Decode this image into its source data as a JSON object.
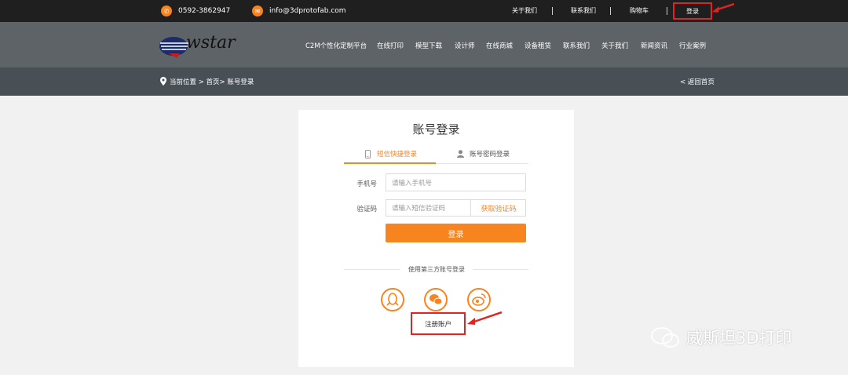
{
  "topbar": {
    "phone": "0592-3862947",
    "email": "info@3dprotofab.com",
    "links": [
      "关于我们",
      "联系我们",
      "购物车"
    ],
    "login": "登录"
  },
  "nav": {
    "logo_text": "wstar",
    "items": [
      "C2M个性化定制平台",
      "在线打印",
      "模型下载",
      "设计师",
      "在线商城",
      "设备租赁",
      "联系我们",
      "关于我们",
      "新闻资讯",
      "行业案例"
    ]
  },
  "breadcrumb": {
    "text": "当前位置 > 首页> 账号登录",
    "back": "< 返回首页"
  },
  "login_card": {
    "title": "账号登录",
    "tabs": [
      "短信快捷登录",
      "账号密码登录"
    ],
    "phone_label": "手机号",
    "phone_placeholder": "请输入手机号",
    "code_label": "验证码",
    "code_placeholder": "请输入短信验证码",
    "get_code": "获取验证码",
    "submit": "登录",
    "third_party": "使用第三方账号登录",
    "register": "注册账户"
  },
  "watermark": "威斯坦3D打印",
  "colors": {
    "accent": "#f7841e",
    "highlight_red": "#e02424"
  }
}
